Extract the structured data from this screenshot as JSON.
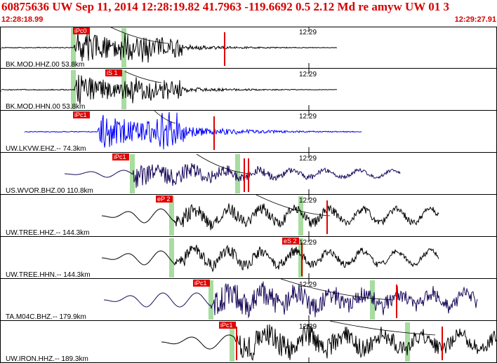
{
  "header": {
    "title": "60875636 UW Sep 11, 2014 12:28:19.82   41.7963 -119.6692  0.5 2.12 Md re amyw UW 01    3",
    "start_time": "12:28:18.99",
    "end_time": "12:29:27.91"
  },
  "tick_label": "12:29",
  "colors": {
    "header_text": "#d60000",
    "trace_default": "#000000",
    "trace_blue": "#0000ff",
    "trace_purple": "#1a0a5a",
    "pick_box": "#e00000",
    "window_green": "#a8dca0",
    "border": "#000000"
  },
  "traces": [
    {
      "label": "BK.MOD.HHZ.00 53.8km",
      "pick": "iPc0",
      "color": "trace_default"
    },
    {
      "label": "BK.MOD.HHN.00 53.8km",
      "pick": "iS 1",
      "color": "trace_default"
    },
    {
      "label": "UW.LKVW.EHZ.-- 74.3km",
      "pick": "iPc1",
      "color": "trace_blue"
    },
    {
      "label": "US.WVOR.BHZ.00 110.8km",
      "pick": "iPc1",
      "color": "trace_purple"
    },
    {
      "label": "UW.TREE.HHZ.-- 144.3km",
      "pick": "eP 2",
      "color": "trace_default"
    },
    {
      "label": "UW.TREE.HHN.-- 144.3km",
      "pick": "eS 2",
      "color": "trace_default"
    },
    {
      "label": "TA.M04C.BHZ.-- 179.9km",
      "pick": "iPc1",
      "color": "trace_purple"
    },
    {
      "label": "UW.IRON.HHZ.-- 189.3km",
      "pick": "iPc1",
      "color": "trace_default"
    }
  ]
}
